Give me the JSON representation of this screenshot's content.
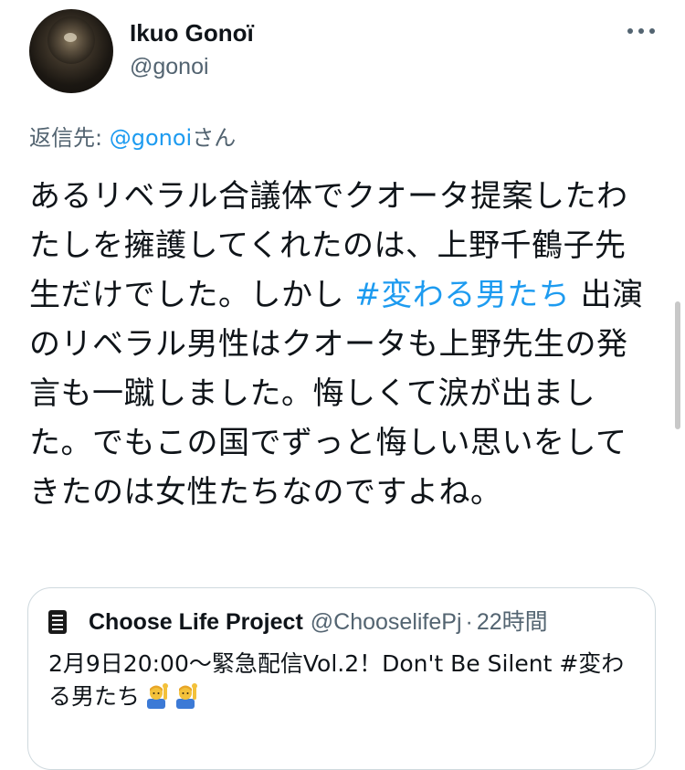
{
  "author": {
    "display_name": "Ikuo Gonoï",
    "handle": "@gonoi",
    "avatar_icon": "profile-photo"
  },
  "reply": {
    "prefix": "返信先: ",
    "handle": "@gonoi",
    "suffix": "さん"
  },
  "body": {
    "segments": [
      "あるリベラル合議体でクオータ提案したわたしを擁護してくれたのは、上野千鶴子先生だけでした。しかし ",
      "#変わる男たち",
      " 出演のリベラル男性はクオータも上野先生の発言も一蹴しました。悔しくて涙が出ました。でもこの国でずっと悔しい思いをしてきたのは女性たちなのですよね。"
    ]
  },
  "quote": {
    "name": "Choose Life Project",
    "handle": "@ChooselifePj",
    "separator": "·",
    "time": "22時間",
    "text": "2月9日20:00〜緊急配信Vol.2！Don't Be Silent #変わる男たち",
    "emojis": [
      "man-raising-hand-emoji",
      "man-raising-hand-emoji"
    ]
  },
  "colors": {
    "link": "#1d9bf0",
    "secondary_text": "#536471",
    "primary_text": "#0f1419",
    "border": "#cfd9de"
  }
}
